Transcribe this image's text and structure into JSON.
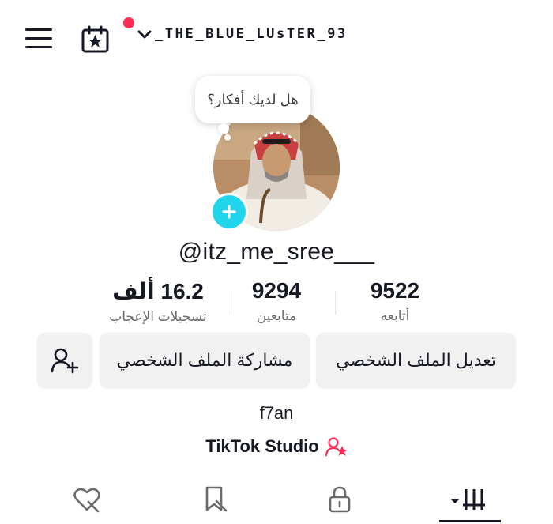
{
  "header": {
    "username": "_THE_BLUE_LUsTER_93",
    "menu_icon": "hamburger-icon",
    "calendar_icon": "calendar-star-icon",
    "dropdown_icon": "chevron-down-icon",
    "notification_color": "#fe2c55"
  },
  "profile": {
    "bubble_text": "هل لديك أفكار؟",
    "handle": "@itz_me_sree___",
    "add_icon_color": "#20d5ec"
  },
  "stats": [
    {
      "value": "16.2 ألف",
      "label": "تسجيلات الإعجاب"
    },
    {
      "value": "9294",
      "label": "متابعين"
    },
    {
      "value": "9522",
      "label": "أتابعه"
    }
  ],
  "actions": {
    "add_friend_icon": "add-user-icon",
    "share_profile": "مشاركة الملف الشخصي",
    "edit_profile": "تعديل الملف الشخصي"
  },
  "bio": "f7an",
  "studio": {
    "label": "TikTok Studio",
    "icon": "user-star-icon",
    "icon_color": "#fe2c55"
  },
  "tabs": [
    {
      "icon": "liked-heart-hidden-icon"
    },
    {
      "icon": "bookmark-hidden-icon"
    },
    {
      "icon": "lock-icon"
    },
    {
      "icon": "videos-grid-icon",
      "active": true
    }
  ]
}
